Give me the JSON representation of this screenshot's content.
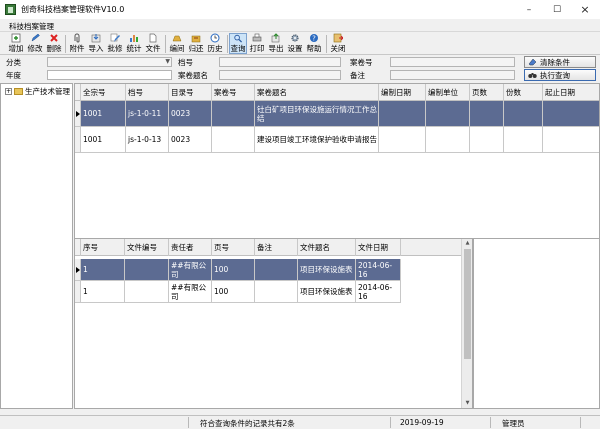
{
  "window": {
    "title": "创奇科技档案管理软件V10.0"
  },
  "menu": {
    "items": [
      "科技档案管理"
    ]
  },
  "toolbar": {
    "buttons": [
      {
        "label": "增加",
        "icon": "add-icon"
      },
      {
        "label": "修改",
        "icon": "edit-icon"
      },
      {
        "label": "删除",
        "icon": "delete-icon"
      },
      {
        "label": "附件",
        "icon": "attachment-icon"
      },
      {
        "label": "导入",
        "icon": "import-icon"
      },
      {
        "label": "批修",
        "icon": "batch-edit-icon"
      },
      {
        "label": "统计",
        "icon": "statistics-icon"
      },
      {
        "label": "文件",
        "icon": "file-icon"
      },
      {
        "label": "编间",
        "icon": "arrange-icon"
      },
      {
        "label": "归还",
        "icon": "return-icon"
      },
      {
        "label": "历史",
        "icon": "history-icon"
      },
      {
        "label": "查询",
        "icon": "search-icon"
      },
      {
        "label": "打印",
        "icon": "print-icon"
      },
      {
        "label": "导出",
        "icon": "export-icon"
      },
      {
        "label": "设置",
        "icon": "settings-icon"
      },
      {
        "label": "帮助",
        "icon": "help-icon"
      },
      {
        "label": "关闭",
        "icon": "close-icon"
      }
    ]
  },
  "filters": {
    "category_label": "分类",
    "category_value": "",
    "archive_no_label": "档号",
    "archive_no_value": "",
    "case_no_label": "案卷号",
    "case_no_value": "",
    "year_label": "年度",
    "year_value": "",
    "case_title_label": "案卷题名",
    "case_title_value": "",
    "remarks_label": "备注",
    "remarks_value": "",
    "clear_button": "清除条件",
    "query_button": "执行查询"
  },
  "tree": {
    "items": [
      {
        "label": "生产技术管理",
        "toggle": "+"
      }
    ]
  },
  "upper_grid": {
    "columns": [
      "全宗号",
      "档号",
      "目录号",
      "案卷号",
      "案卷题名",
      "编制日期",
      "编制单位",
      "页数",
      "份数",
      "起止日期"
    ],
    "rows": [
      {
        "selected": true,
        "cells": [
          "1001",
          "js-1-0-11",
          "0023",
          "",
          "钍白矿项目环保设施运行情况工作总结",
          "",
          "",
          "",
          "",
          ""
        ]
      },
      {
        "selected": false,
        "cells": [
          "1001",
          "js-1-0-13",
          "0023",
          "",
          "建设项目竣工环境保护验收申请报告",
          "",
          "",
          "",
          "",
          ""
        ]
      }
    ]
  },
  "lower_grid": {
    "columns": [
      "序号",
      "文件编号",
      "责任者",
      "页号",
      "备注",
      "文件题名",
      "文件日期"
    ],
    "rows": [
      {
        "selected": true,
        "cells": [
          "1",
          "",
          "##有限公司",
          "100",
          "",
          "项目环保设施表",
          "2014-06-16"
        ]
      },
      {
        "selected": false,
        "cells": [
          "1",
          "",
          "##有限公司",
          "100",
          "",
          "项目环保设施表",
          "2014-06-16"
        ]
      }
    ]
  },
  "status": {
    "records": "符合查询条件的记录共有2条",
    "date": "2019-09-19",
    "user": "管理员"
  }
}
